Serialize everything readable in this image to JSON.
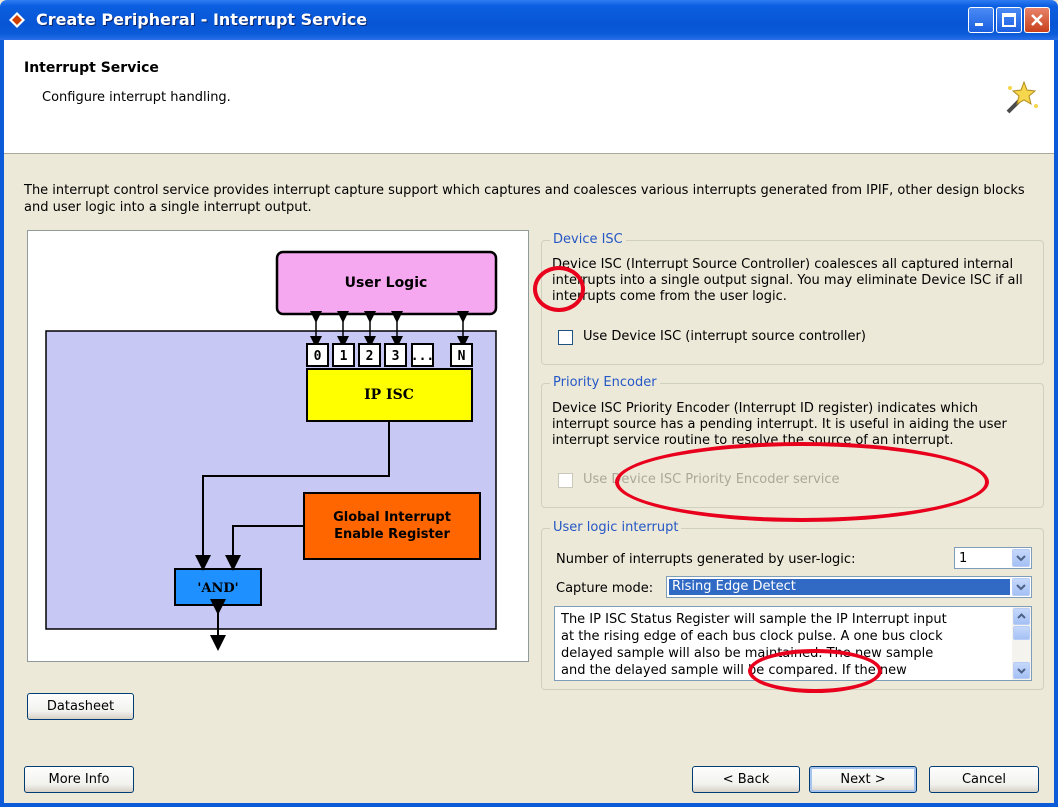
{
  "window": {
    "title": "Create Peripheral - Interrupt Service"
  },
  "header": {
    "title": "Interrupt Service",
    "subtitle": "Configure interrupt handling."
  },
  "description": "The interrupt control service provides interrupt capture support which captures and coalesces various interrupts generated from IPIF, other design blocks and user logic into a single interrupt output.",
  "diagram": {
    "user_logic": "User Logic",
    "ports": [
      "0",
      "1",
      "2",
      "3",
      "...",
      "N"
    ],
    "ip_isc": "IP ISC",
    "global_interrupt_line1": "Global Interrupt",
    "global_interrupt_line2": "Enable Register",
    "and_gate": "'AND'"
  },
  "device_isc": {
    "legend": "Device ISC",
    "text": "Device ISC (Interrupt Source Controller) coalesces all captured internal interrupts into a single output signal. You may eliminate Device ISC if all interrupts come from the user logic.",
    "checkbox_label": "Use Device ISC (interrupt source controller)",
    "checked": false
  },
  "priority_encoder": {
    "legend": "Priority Encoder",
    "text": "Device ISC Priority Encoder (Interrupt ID register) indicates which interrupt source has a pending interrupt. It is useful in aiding the user interrupt service routine to resolve the source of an interrupt.",
    "checkbox_label": "Use Device ISC Priority Encoder service",
    "checked": false,
    "enabled": false
  },
  "user_logic_interrupt": {
    "legend": "User logic interrupt",
    "count_label": "Number of interrupts generated by user-logic:",
    "count_value": "1",
    "capture_label": "Capture mode:",
    "capture_value": "Rising Edge Detect",
    "capture_description": "The IP ISC Status Register will sample the IP Interrupt input at the rising edge of each bus clock pulse. A one bus clock delayed sample will also be maintained. The new sample and the delayed sample will be compared. If the new sample is"
  },
  "buttons": {
    "datasheet": "Datasheet",
    "more_info": "More Info",
    "back": "< Back",
    "next": "Next >",
    "cancel": "Cancel"
  },
  "colors": {
    "titlebar": "#0856d6",
    "user_logic_box": "#f5a8f0",
    "ip_isc_box": "#ffff00",
    "global_interrupt_box": "#ff6600",
    "and_box": "#1e90ff",
    "diagram_bg": "#c8c8f5",
    "annotation": "#e8001c"
  }
}
